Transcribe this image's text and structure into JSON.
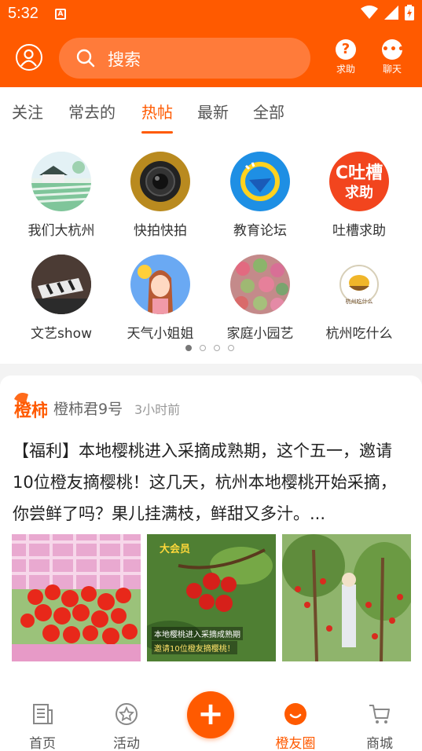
{
  "status_bar": {
    "time": "5:32",
    "notification_badge": "A"
  },
  "header": {
    "search_placeholder": "搜索",
    "help_label": "求助",
    "chat_label": "聊天",
    "accent": "#ff5a00"
  },
  "tabs": [
    {
      "label": "关注"
    },
    {
      "label": "常去的"
    },
    {
      "label": "热帖"
    },
    {
      "label": "最新"
    },
    {
      "label": "全部"
    }
  ],
  "active_tab": "热帖",
  "categories": [
    {
      "name": "我们大杭州",
      "icon": "rice-field-illustration-icon"
    },
    {
      "name": "快拍快拍",
      "icon": "camera-lens-icon"
    },
    {
      "name": "教育论坛",
      "icon": "speech-bubble-icon"
    },
    {
      "name": "吐槽求助",
      "icon": "complain-help-badge-icon"
    },
    {
      "name": "文艺show",
      "icon": "film-clapper-icon"
    },
    {
      "name": "天气小姐姐",
      "icon": "weather-girl-avatar-icon"
    },
    {
      "name": "家庭小园艺",
      "icon": "succulent-plants-icon"
    },
    {
      "name": "杭州吃什么",
      "icon": "food-bowl-logo-icon"
    }
  ],
  "pagination": {
    "pages": 4,
    "current": 1
  },
  "post": {
    "author": "橙柿君9号",
    "time": "3小时前",
    "text": "【福利】本地樱桃进入采摘成熟期，这个五一，邀请10位橙友摘樱桃！这几天，杭州本地樱桃开始采摘，你尝鲜了吗？果儿挂满枝，鲜甜又多汁。...",
    "photo2_caption_top": "大会员",
    "photo2_caption_line1": "本地樱桃进入采摘成熟期",
    "photo2_caption_line2": "邀请10位橙友摘樱桃！"
  },
  "bottom_nav": [
    {
      "label": "首页",
      "icon": "newspaper-icon"
    },
    {
      "label": "活动",
      "icon": "star-circle-icon"
    },
    {
      "label": "",
      "icon": "plus-icon"
    },
    {
      "label": "橙友圈",
      "icon": "smile-circle-icon"
    },
    {
      "label": "商城",
      "icon": "shopping-cart-icon"
    }
  ],
  "active_nav": "橙友圈"
}
